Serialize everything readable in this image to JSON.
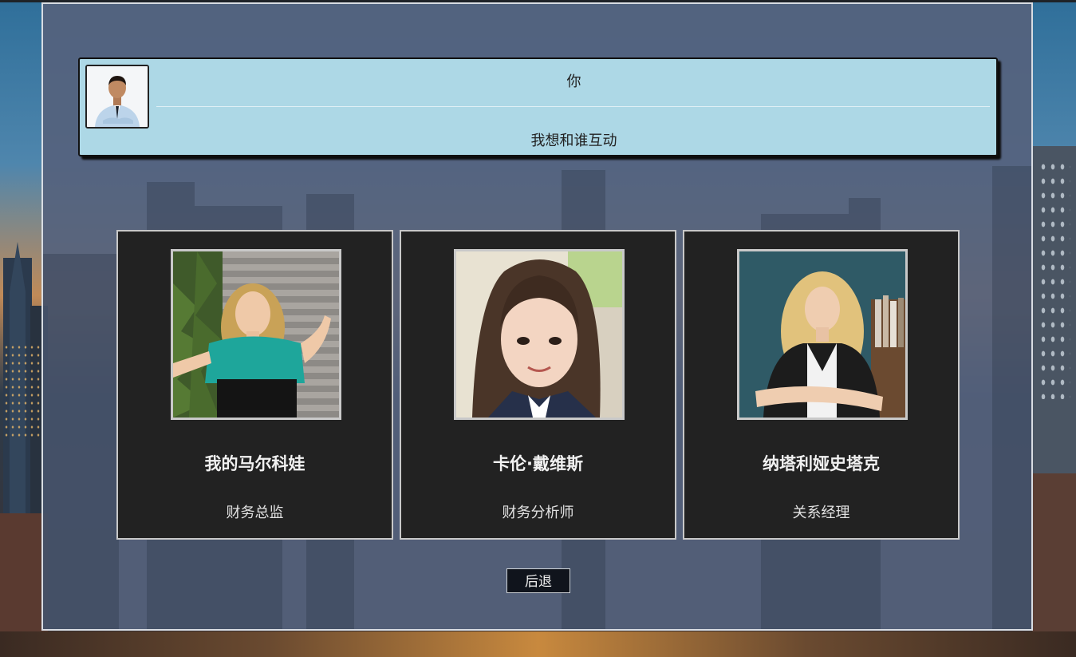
{
  "header": {
    "name": "你",
    "prompt": "我想和谁互动"
  },
  "characters": [
    {
      "name": "我的马尔科娃",
      "role": "财务总监"
    },
    {
      "name": "卡伦·戴维斯",
      "role": "财务分析师"
    },
    {
      "name": "纳塔利娅史塔克",
      "role": "关系经理"
    }
  ],
  "back_button": {
    "label": "后退"
  },
  "colors": {
    "header_bg": "#add8e6",
    "card_bg": "#222222",
    "panel_bg": "#55627d",
    "button_bg": "#10141c"
  }
}
